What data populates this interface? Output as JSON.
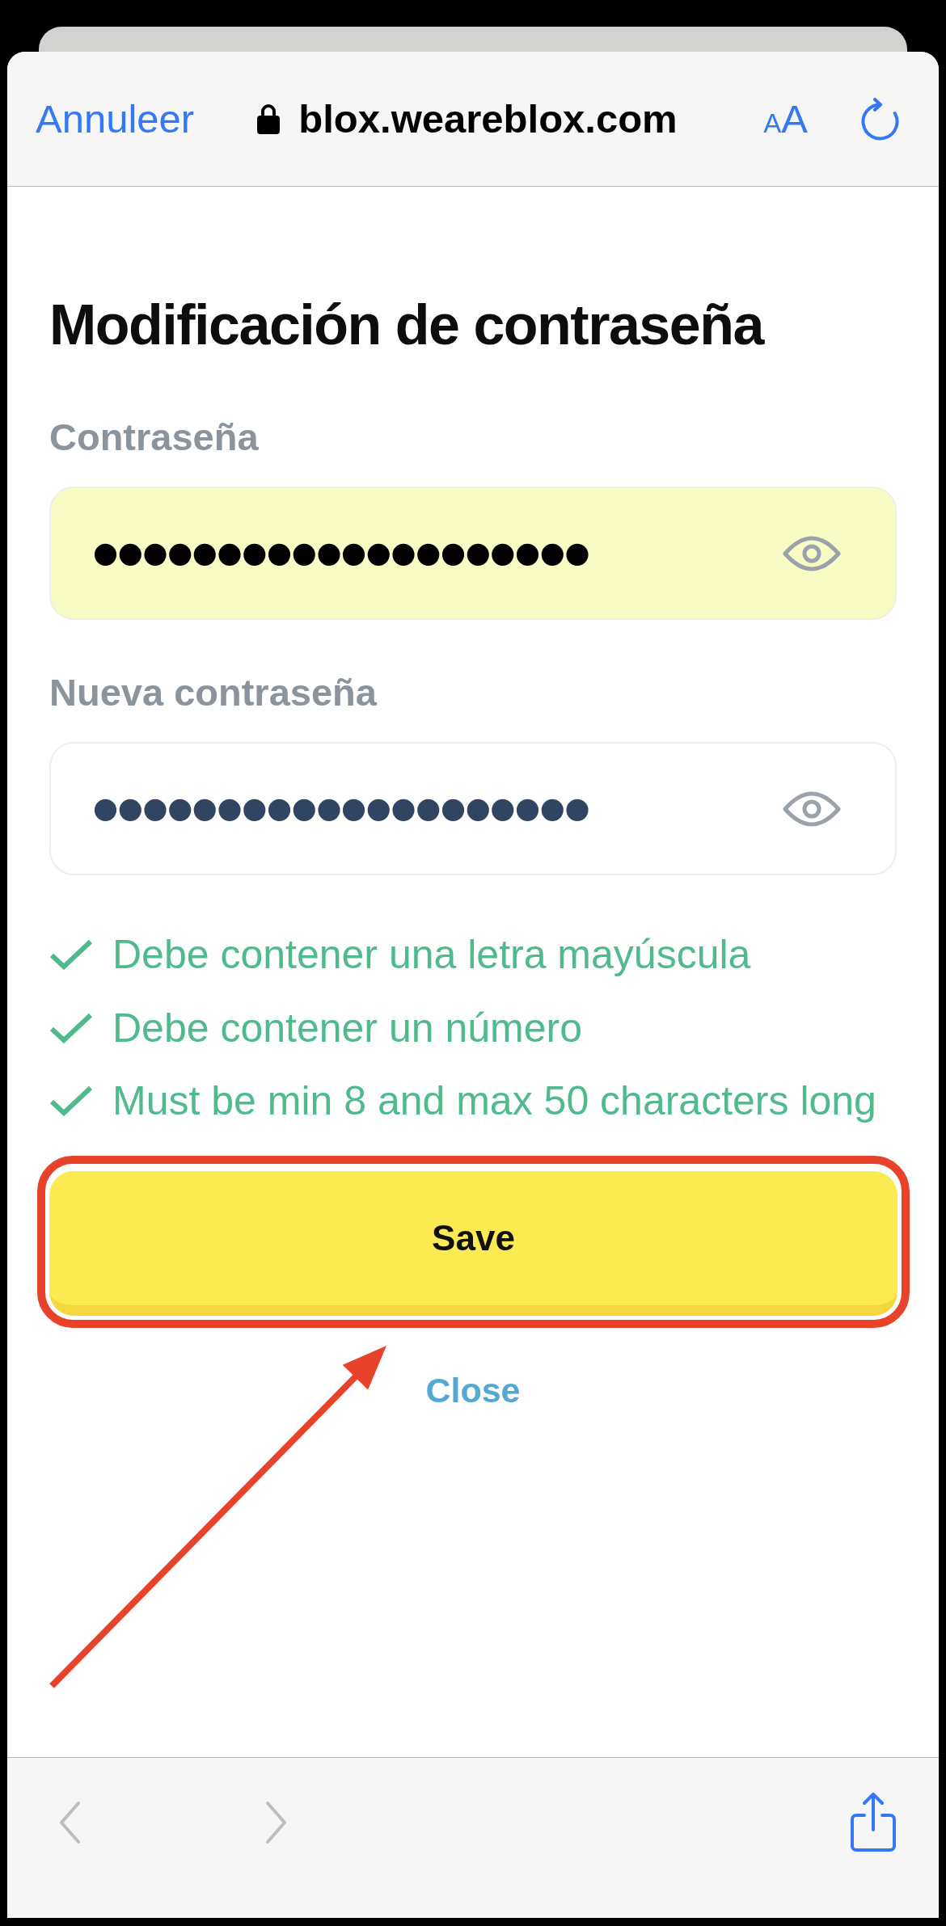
{
  "browser_top_bar": {
    "cancel_button": "Annuleer",
    "address": {
      "secure": true,
      "url": "blox.weareblox.com"
    },
    "text_size_button": {
      "small_letter": "A",
      "large_letter": "A"
    }
  },
  "form": {
    "title": "Modificación de contraseña",
    "fields": [
      {
        "label": "Contraseña",
        "value": "••••••••••••••••••••",
        "autofilled": true
      },
      {
        "label": "Nueva contraseña",
        "value": "••••••••••••••••••••",
        "autofilled": false
      }
    ],
    "requirements": [
      {
        "text": "Debe contener una letra mayúscula",
        "met": true
      },
      {
        "text": "Debe contener un número",
        "met": true
      },
      {
        "text": "Must be min 8 and max 50 characters long",
        "met": true
      }
    ],
    "save_button": "Save",
    "close_link": "Close"
  },
  "browser_bottom_bar": {
    "buttons": [
      {
        "kind": "back",
        "disabled": true
      },
      {
        "kind": "forward",
        "disabled": true
      },
      {
        "kind": "share",
        "disabled": false
      }
    ]
  }
}
